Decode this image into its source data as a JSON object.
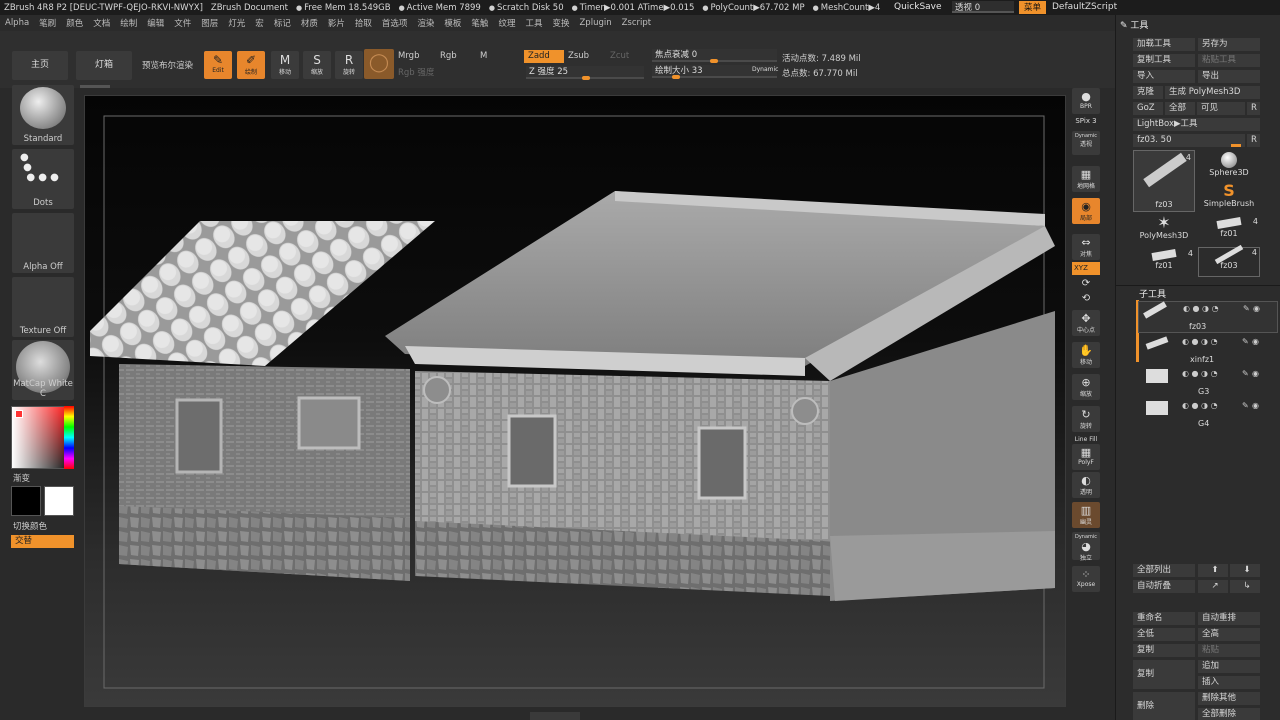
{
  "titlebar": {
    "app": "ZBrush 4R8 P2 [DEUC-TWPF-QEJO-RKVI-NWYX]",
    "document": "ZBrush Document",
    "free_mem": "Free Mem 18.549GB",
    "active_mem": "Active Mem 7899",
    "scratch_disk": "Scratch Disk 50",
    "timer": "Timer▶0.001 ATime▶0.015",
    "polycount": "PolyCount▶67.702 MP",
    "meshcount": "MeshCount▶4",
    "quicksave": "QuickSave",
    "transparency": "透视 0",
    "menu": "菜单",
    "default_zscript": "DefaultZScript"
  },
  "menubar": [
    "Alpha",
    "笔刷",
    "颜色",
    "文档",
    "绘制",
    "编辑",
    "文件",
    "图层",
    "灯光",
    "宏",
    "标记",
    "材质",
    "影片",
    "拾取",
    "首选项",
    "渲染",
    "模板",
    "笔触",
    "纹理",
    "工具",
    "变换",
    "Zplugin",
    "Zscript"
  ],
  "shelf": {
    "home": "主页",
    "lightbox": "灯箱",
    "bpr_preview": "预览布尔渲染",
    "edit": "Edit",
    "draw": "绘制",
    "move": "移动",
    "scale": "缩放",
    "rotate": "旋转",
    "mrgb": "Mrgb",
    "rgb": "Rgb",
    "m": "M",
    "rgb_intensity": "Rgb 强度",
    "zadd": "Zadd",
    "zsub": "Zsub",
    "zcut": "Zcut",
    "z_intensity": "Z 强度 25",
    "focal_shift": "焦点衰减 0",
    "draw_size": "绘制大小 33",
    "dynamic": "Dynamic",
    "active_points": "活动点数: 7.489 Mil",
    "total_points": "总点数: 67.770 Mil"
  },
  "leftpanel": {
    "brush": "Standard",
    "stroke": "Dots",
    "alpha": "Alpha Off",
    "texture": "Texture Off",
    "material": "MatCap White C",
    "gradient": "渐变",
    "switch_color": "切换颜色",
    "alternate": "交替"
  },
  "rightstrip": {
    "bpr": "BPR",
    "spix": "SPix 3",
    "dynamic": "Dynamic",
    "perspective": "透视",
    "floor": "地网格",
    "local": "局部",
    "xyz": "XYZ",
    "frame": "对焦",
    "center": "中心点",
    "move": "移动",
    "scale": "缩放",
    "rotate": "旋转",
    "linefill": "Line Fill",
    "polyf": "PolyF",
    "transp": "透明",
    "ghost": "幽灵",
    "solo": "独立",
    "xpose": "Xpose"
  },
  "toolpanel": {
    "title": "工具",
    "load_tool": "加载工具",
    "save_as": "另存为",
    "copy_tool": "复制工具",
    "paste_tool": "粘贴工具",
    "import": "导入",
    "export": "导出",
    "clone": "克隆",
    "make_polymesh": "生成 PolyMesh3D",
    "goz": "GoZ",
    "all": "全部",
    "visible": "可见",
    "r": "R",
    "lightbox_tool": "LightBox▶工具",
    "current_tool": "fz03. 50",
    "thumbs": [
      {
        "name": "fz03",
        "count": "4"
      },
      {
        "name": "Sphere3D",
        "count": ""
      },
      {
        "name": "SimpleBrush",
        "count": ""
      },
      {
        "name": "PolyMesh3D",
        "count": ""
      },
      {
        "name": "fz01",
        "count": "4"
      },
      {
        "name": "fz01",
        "count": "4"
      },
      {
        "name": "fz03",
        "count": "4"
      }
    ],
    "subtool_title": "子工具",
    "subtools": [
      "fz03",
      "xinfz1",
      "G3",
      "G4"
    ],
    "list_all": "全部列出",
    "auto_collapse": "自动折叠",
    "rename": "重命名",
    "auto_reorder": "自动重排",
    "all_low": "全低",
    "all_high": "全高",
    "duplicate": "复制",
    "paste": "粘贴",
    "copy": "复制",
    "append": "追加",
    "insert": "插入",
    "delete": "删除",
    "delete_other": "删除其他",
    "delete_all": "全部删除"
  },
  "colors": {
    "accent": "#f0922b",
    "panel": "#2c2c2c",
    "button": "#3a3a3a"
  }
}
